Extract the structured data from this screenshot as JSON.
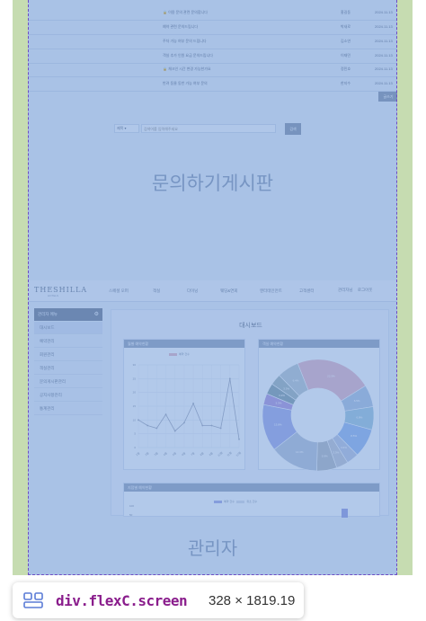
{
  "devtools": {
    "selector": "div.flexC.screen",
    "dimensions": "328 × 1819.19"
  },
  "board": {
    "rows": [
      {
        "num": "",
        "title": "🔒 이용 문의 관련 문의합니다",
        "author": "홍길동",
        "date": "2024.11.13"
      },
      {
        "num": "",
        "title": "예약 관련 문의드립니다",
        "author": "박새로",
        "date": "2024.11.13"
      },
      {
        "num": "",
        "title": "주차 가능 여부 문의 드립니다",
        "author": "김소연",
        "date": "2024.11.13"
      },
      {
        "num": "",
        "title": "객실 추가 인원 요금 문의드립니다",
        "author": "이재민",
        "date": "2024.11.13"
      },
      {
        "num": "",
        "title": "🔒 체크인 시간 변경 가능한가요",
        "author": "정민호",
        "date": "2024.11.13"
      },
      {
        "num": "",
        "title": "반려 동물 동반 가능 여부 문의",
        "author": "한지수",
        "date": "2024.11.13"
      }
    ],
    "write_label": "글쓰기",
    "search_select": "제목",
    "search_placeholder": "검색어를 입력해주세요",
    "search_button": "검색",
    "section_label": "문의하기게시판"
  },
  "admin": {
    "brand": "THESHILLA",
    "brand_sub": "HOTELS",
    "nav": [
      "스페셜 오퍼",
      "객실",
      "다이닝",
      "웨딩&연회",
      "엔터테인먼트",
      "고객센터"
    ],
    "header_right": [
      "관리자님",
      "로그아웃"
    ],
    "sidebar_title": "관리자 메뉴",
    "sidebar_items": [
      "대시보드",
      "예약관리",
      "회원관리",
      "객실관리",
      "문의게시판관리",
      "공지사항관리",
      "통계관리"
    ],
    "dashboard_title": "대시보드",
    "line_card_title": "월별 예약현황",
    "pie_card_title": "객실 예약현황",
    "bar_card_title": "지점별 예약현황",
    "line_legend": "예약 건수",
    "bar_legend": [
      "예약 건수",
      "취소 건수"
    ],
    "bar_ylabels": [
      "100",
      "50"
    ],
    "section_label": "관리자"
  },
  "chart_data": [
    {
      "type": "line",
      "title": "월별 예약현황",
      "series": [
        {
          "name": "예약 건수",
          "values": [
            10,
            8,
            7,
            12,
            6,
            9,
            16,
            8,
            8,
            7,
            25,
            3
          ]
        }
      ],
      "x": [
        "1월",
        "2월",
        "3월",
        "4월",
        "5월",
        "6월",
        "7월",
        "8월",
        "9월",
        "10월",
        "11월",
        "12월"
      ],
      "ylim": [
        0,
        30
      ],
      "yticks": [
        "0",
        "5",
        "10",
        "15",
        "20",
        "25",
        "30"
      ],
      "grid": true
    },
    {
      "type": "pie",
      "title": "객실 예약현황",
      "values": [
        22.5,
        6.5,
        6.8,
        8.5,
        3.6,
        3.5,
        5.9,
        14.3,
        13.8,
        3.3,
        3.2,
        3.3,
        6.4
      ],
      "labels": [
        "22.5%",
        "6.5%",
        "6.8%",
        "8.5%",
        "3.6%",
        "3.5%",
        "5.9%",
        "14.3%",
        "13.8%",
        "3.3%",
        "3.2%",
        "3.3%",
        "6.4%"
      ],
      "colors": [
        "#d9a4b8",
        "#9ab3d6",
        "#89b8d3",
        "#7fa6e6",
        "#a8b5d6",
        "#b0b7c6",
        "#9fa8b3",
        "#a5b4cc",
        "#8c98e0",
        "#9b7fd0",
        "#6c8a94",
        "#8aa3a8",
        "#a6b9c4"
      ],
      "donut": true
    }
  ]
}
